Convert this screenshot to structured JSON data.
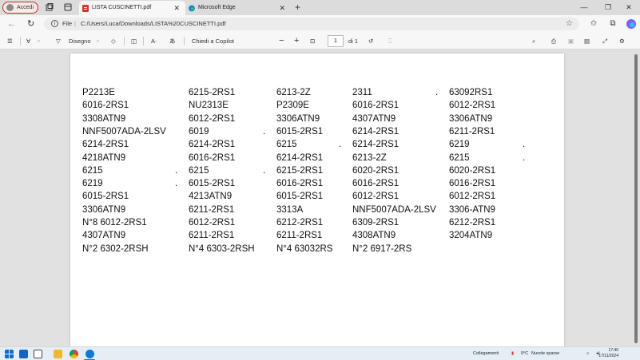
{
  "browser": {
    "profile_label": "Accedi",
    "tabs": [
      {
        "title": "LISTA CUSCINETTI.pdf",
        "active": true
      },
      {
        "title": "Microsoft Edge",
        "active": false
      }
    ],
    "address": {
      "scheme_label": "File",
      "separator": "|",
      "path": "C:/Users/Luca/Downloads/LISTA%20CUSCINETTI.pdf"
    }
  },
  "pdf_toolbar": {
    "draw_label": "Disegno",
    "copilot_label": "Chiedi a Copilot",
    "page_current": "1",
    "page_total": "di 1"
  },
  "document": {
    "rows": [
      [
        "P2213E",
        "6215-2RS1",
        "6213-2Z",
        "2311",
        ".",
        "63092RS1"
      ],
      [
        "6016-2RS1",
        "NU2313E",
        "P2309E",
        "6016-2RS1",
        "6012-2RS1"
      ],
      [
        "3308ATN9",
        "6012-2RS1",
        "3306ATN9",
        "4307ATN9",
        "3306ATN9"
      ],
      [
        "NNF5007ADA-2LSV",
        "6019",
        ".",
        "6015-2RS1",
        "6214-2RS1",
        "6211-2RS1"
      ],
      [
        "6214-2RS1",
        "6214-2RS1",
        "6215",
        ".",
        "6214-2RS1",
        "6219",
        "."
      ],
      [
        "4218ATN9",
        "6016-2RS1",
        "6214-2RS1",
        "6213-2Z",
        "6215",
        "."
      ],
      [
        "6215",
        ".",
        "6215",
        ".",
        "6215-2RS1",
        "6020-2RS1",
        "6020-2RS1"
      ],
      [
        "6219",
        ".",
        "6015-2RS1",
        "6016-2RS1",
        "6016-2RS1",
        "6016-2RS1"
      ],
      [
        "6015-2RS1",
        "4213ATN9",
        "6015-2RS1",
        "6012-2RS1",
        "6012-2RS1"
      ],
      [
        "3306ATN9",
        "6211-2RS1",
        "3313A",
        "NNF5007ADA-2LSV",
        "3306-ATN9"
      ],
      [
        "N°8 6012-2RS1",
        "6012-2RS1",
        "6212-2RS1",
        "6309-2RS1",
        "6212-2RS1"
      ],
      [
        "4307ATN9",
        "6211-2RS1",
        "6211-2RS1",
        "4308ATN9",
        "3204ATN9"
      ],
      [
        "N°2 6302-2RSH",
        "N°4 6303-2RSH",
        "N°4 63032RS",
        "N°2 6917-2RS"
      ]
    ]
  },
  "taskbar": {
    "tray_news": "Collegamenti",
    "weather_temp": "9°C",
    "weather_desc": "Nuvole sparse",
    "time": "17:40",
    "date": "17/11/2024"
  },
  "colors": {
    "accent_red": "#c42b1c",
    "edge_blue": "#0f7bd6",
    "pdf_red": "#e0312d"
  },
  "icons": [
    "person-icon",
    "workspaces-icon",
    "tab-actions-icon",
    "pdf-file-icon",
    "edge-icon",
    "close-icon",
    "plus-icon",
    "minimize-icon",
    "maximize-icon",
    "back-arrow-icon",
    "refresh-icon",
    "info-icon",
    "star-icon",
    "favorites-icon",
    "collections-icon",
    "copilot-icon",
    "contents-icon",
    "highlight-icon",
    "draw-icon",
    "eraser-icon",
    "page-view-icon",
    "read-aloud-icon",
    "translate-icon",
    "zoom-out-icon",
    "zoom-in-icon",
    "fit-page-icon",
    "rotate-icon",
    "search-icon",
    "print-icon",
    "save-icon",
    "save-as-icon",
    "fullscreen-icon",
    "settings-icon",
    "windows-start-icon",
    "outlook-icon",
    "task-view-icon",
    "file-explorer-icon",
    "chrome-icon",
    "weather-icon",
    "network-icon",
    "volume-icon"
  ]
}
